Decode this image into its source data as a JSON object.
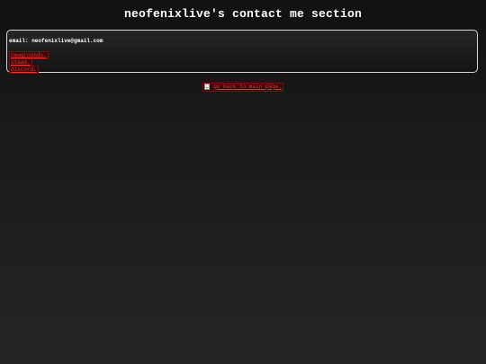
{
  "page": {
    "title": "neofenixlive's contact me section"
  },
  "contact": {
    "email_line": "email: neofenixlive@gmail.com",
    "links": [
      {
        "label": "newgrounds."
      },
      {
        "label": "steam."
      },
      {
        "label": "discord."
      }
    ]
  },
  "footer": {
    "back_label": "go back to main page.",
    "back_icon": "broken-image-icon"
  },
  "colors": {
    "background": "#1a1a1a",
    "text": "#ffffff",
    "link": "#e03a3a",
    "link_bg": "#3a0505",
    "box_border": "#d8d8d8"
  }
}
